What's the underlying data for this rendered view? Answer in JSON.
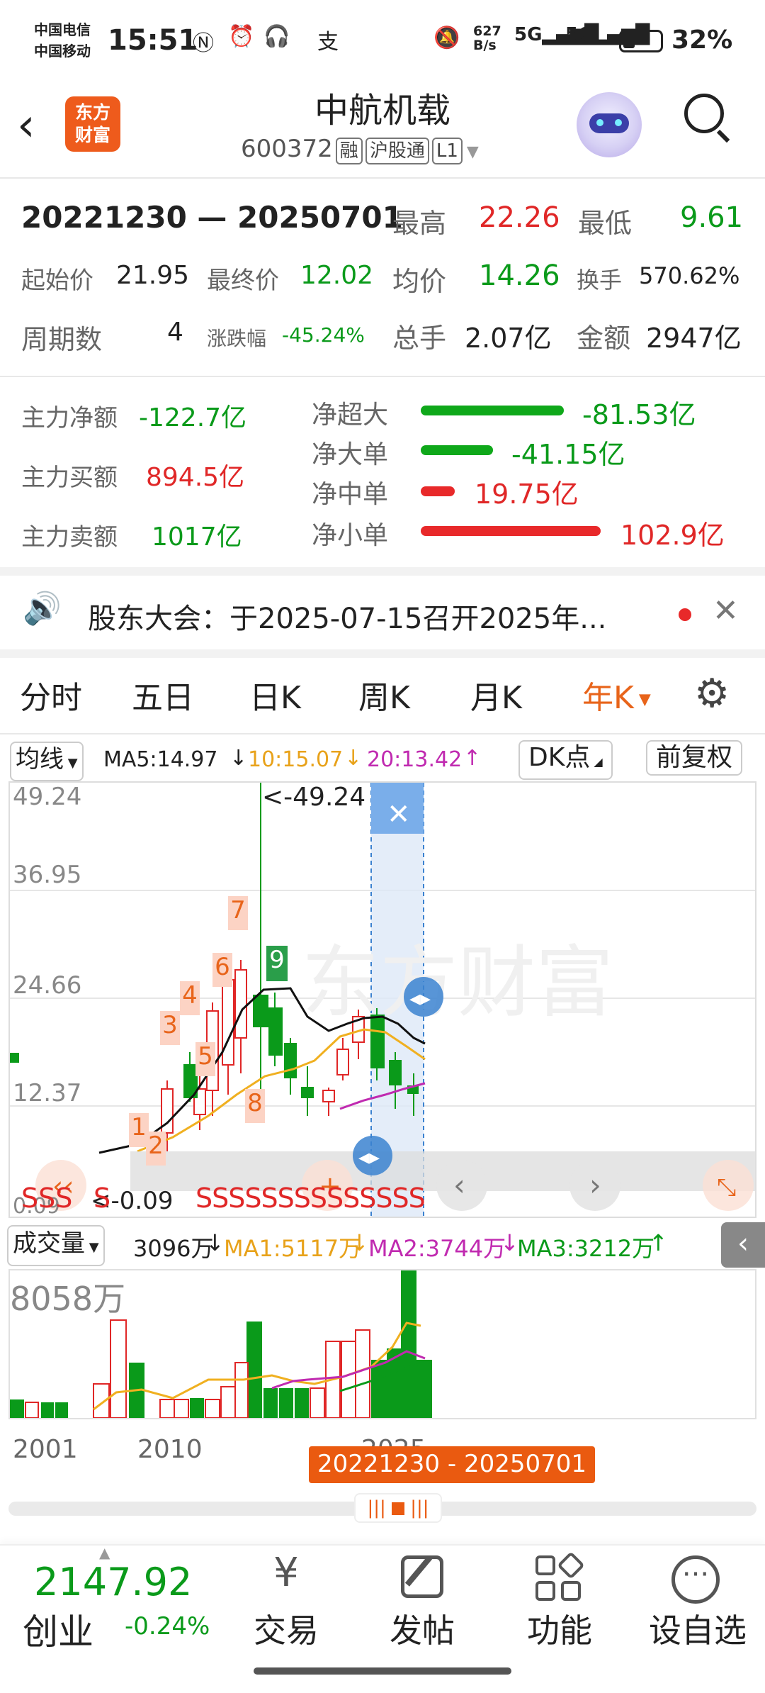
{
  "status": {
    "carrier1": "中国电信",
    "carrier2": "中国移动",
    "time": "15:51",
    "speed": "627\nB/s",
    "battery": "32%"
  },
  "header": {
    "logo": "东方\n财富",
    "title": "中航机载",
    "code": "600372",
    "tags": [
      "融",
      "沪股通",
      "L1"
    ]
  },
  "summary": {
    "range": "20221230 — 20250701",
    "high_label": "最高",
    "high_value": "22.26",
    "low_label": "最低",
    "low_value": "9.61",
    "start_label": "起始价",
    "start_value": "21.95",
    "end_label": "最终价",
    "end_value": "12.02",
    "avg_label": "均价",
    "avg_value": "14.26",
    "turnover_label": "换手",
    "turnover_value": "570.62%",
    "periods_label": "周期数",
    "periods_value": "4",
    "change_label": "涨跌幅",
    "change_value": "-45.24%",
    "volume_label": "总手",
    "volume_value": "2.07亿",
    "amount_label": "金额",
    "amount_value": "2947亿"
  },
  "flow": {
    "net_label": "主力净额",
    "net_value": "-122.7亿",
    "buy_label": "主力买额",
    "buy_value": "894.5亿",
    "sell_label": "主力卖额",
    "sell_value": "1017亿",
    "bars": [
      {
        "label": "净超大",
        "value": "-81.53亿"
      },
      {
        "label": "净大单",
        "value": "-41.15亿"
      },
      {
        "label": "净中单",
        "value": "19.75亿"
      },
      {
        "label": "净小单",
        "value": "102.9亿"
      }
    ]
  },
  "notice": {
    "text": "股东大会：于2025-07-15召开2025年..."
  },
  "tabs": [
    "分时",
    "五日",
    "日K",
    "周K",
    "月K",
    "年K"
  ],
  "kline": {
    "ma_select": "均线",
    "ma5": "MA5:14.97",
    "ma10": "10:15.07",
    "ma20": "20:13.42",
    "dk_label": "DK点",
    "restore_label": "前复权",
    "ticks": [
      "49.24",
      "36.95",
      "24.66",
      "12.37",
      "0.09"
    ],
    "max_callout": "<-49.24",
    "min_callout": "<-0.09",
    "s_marks": "SSSSSSSSSSSSSS",
    "s_left": "SSS",
    "s_left2": "S",
    "labels": [
      "1",
      "2",
      "3",
      "4",
      "5",
      "6",
      "7",
      "8",
      "9"
    ]
  },
  "volume": {
    "select": "成交量",
    "current": "3096万",
    "ma1": "MA1:5117万",
    "ma2": "MA2:3744万",
    "ma3": "MA3:3212万",
    "max": "8058万"
  },
  "timeline": {
    "years": [
      "2001",
      "2010",
      "2025"
    ],
    "range": "20221230 - 20250701"
  },
  "bottom": {
    "index_value": "2147.92",
    "index_name": "创业",
    "index_change": "-0.24%",
    "nav": [
      "交易",
      "发帖",
      "功能",
      "设自选"
    ]
  },
  "colors": {
    "up": "#e02727",
    "down": "#0a9a1a",
    "accent": "#e8641a",
    "selection": "#5b9be0"
  }
}
